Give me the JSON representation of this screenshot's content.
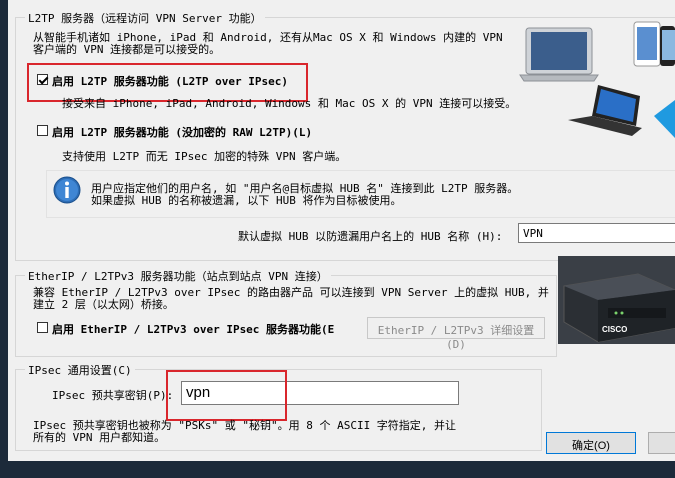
{
  "l2tp": {
    "group_title": "L2TP 服务器（远程访问 VPN Server 功能）",
    "description_line1": "从智能手机诸如 iPhone, iPad 和 Android, 还有从Mac OS X 和 Windows 内建的 VPN",
    "description_line2": "客户端的 VPN 连接都是可以接受的。",
    "option_ipsec": {
      "label": "启用 L2TP 服务器功能 (L2TP over IPsec)",
      "checked": true,
      "description": "接受来自 iPhone, iPad, Android, Windows 和 Mac OS X 的 VPN 连接可以接受。"
    },
    "option_raw": {
      "label": "启用 L2TP 服务器功能 (没加密的 RAW L2TP)(L)",
      "checked": false,
      "description": "支持使用 L2TP 而无 IPsec 加密的特殊 VPN 客户端。"
    },
    "info_line1": "用户应指定他们的用户名, 如 \"用户名@目标虚拟 HUB 名\" 连接到此 L2TP 服务器。",
    "info_line2": "如果虚拟 HUB 的名称被遗漏, 以下 HUB 将作为目标被使用。",
    "default_hub_label": "默认虚拟 HUB 以防遗漏用户名上的 HUB 名称 (H):",
    "default_hub_value": "VPN"
  },
  "etherip": {
    "group_title": "EtherIP / L2TPv3 服务器功能（站点到站点 VPN 连接）",
    "description_line1": "兼容 EtherIP / L2TPv3 over IPsec 的路由器产品 可以连接到 VPN Server 上的虚拟 HUB, 并",
    "description_line2": "建立 2 层（以太网）桥接。",
    "option": {
      "label": "启用 EtherIP / L2TPv3 over IPsec 服务器功能(E",
      "checked": false
    },
    "detail_button": "EtherIP / L2TPv3 详细设置(D)",
    "router_brand": "CISCO"
  },
  "ipsec": {
    "group_title": "IPsec 通用设置(C)",
    "psk_label": "IPsec 预共享密钥(P):",
    "psk_value": "vpn",
    "note_line1": "IPsec 预共享密钥也被称为 \"PSKs\" 或 \"秘钥\"。用 8 个 ASCII 字符指定, 并让",
    "note_line2": "所有的 VPN 用户都知道。"
  },
  "buttons": {
    "ok": "确定(O)"
  },
  "colors": {
    "highlight": "#d9262c",
    "window_bg": "#f0f0f0",
    "taskbar": "#1c2a3a"
  }
}
